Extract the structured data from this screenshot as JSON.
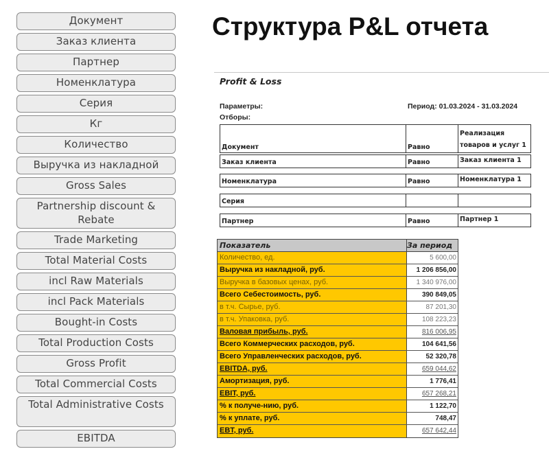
{
  "title": "Структура P&L отчета",
  "sidebar": {
    "items": [
      {
        "label": "Документ"
      },
      {
        "label": "Заказ клиента"
      },
      {
        "label": "Партнер"
      },
      {
        "label": "Номенклатура"
      },
      {
        "label": "Серия"
      },
      {
        "label": "Кг"
      },
      {
        "label": "Количество"
      },
      {
        "label": "Выручка из накладной"
      },
      {
        "label": "Gross Sales"
      },
      {
        "label": "Partnership discount & Rebate"
      },
      {
        "label": "Trade Marketing"
      },
      {
        "label": "Total Material Costs"
      },
      {
        "label": "incl Raw Materials"
      },
      {
        "label": "incl Pack Materials"
      },
      {
        "label": "Bought-in Costs"
      },
      {
        "label": "Total Production Costs"
      },
      {
        "label": "Gross Profit"
      },
      {
        "label": "Total Commercial Costs"
      },
      {
        "label": "Total Administrative Costs"
      },
      {
        "label": "EBITDA"
      }
    ]
  },
  "report": {
    "title": "Profit & Loss",
    "params_label": "Параметры:",
    "period": "Период: 01.03.2024 - 31.03.2024",
    "filters_label": "Отборы:",
    "filters": [
      {
        "field": "Документ",
        "condition": "Равно",
        "value": "Реализация\nтоваров и услуг 1"
      },
      {
        "field": "Заказ клиента",
        "condition": "Равно",
        "value": "Заказ клиента 1"
      },
      {
        "field": "Номенклатура",
        "condition": "Равно",
        "value": "Номенклатура 1"
      },
      {
        "field": "Серия",
        "condition": "",
        "value": ""
      },
      {
        "field": "Партнер",
        "condition": "Равно",
        "value": "Партнер 1"
      }
    ],
    "table": {
      "headers": [
        "Показатель",
        "За период"
      ],
      "rows": [
        {
          "label": "Количество, ед.",
          "value": "5 600,00",
          "style": "muted"
        },
        {
          "label": "Выручка из накладной, руб.",
          "value": "1 206 856,00",
          "style": "bold"
        },
        {
          "label": "Выручка в базовых ценах, руб.",
          "value": "1 340 976,00",
          "style": "muted"
        },
        {
          "label": "Всего Себестоимость, руб.",
          "value": "390 849,05",
          "style": "bold"
        },
        {
          "label": "в т.ч. Сырье, руб.",
          "value": "87 201,30",
          "style": "muted"
        },
        {
          "label": "в т.ч. Упаковка, руб.",
          "value": "108 223,23",
          "style": "muted"
        },
        {
          "label": "Валовая прибыль, руб.",
          "value": "816 006,95",
          "style": "ul"
        },
        {
          "label": "Всего Коммерческих расходов, руб.",
          "value": "104 641,56",
          "style": "bold"
        },
        {
          "label": "Всего Управленческих расходов, руб.",
          "value": "52 320,78",
          "style": "bold"
        },
        {
          "label": "EBITDA, руб.",
          "value": "659 044,62",
          "style": "ul"
        },
        {
          "label": "Амортизация, руб.",
          "value": "1 776,41",
          "style": "bold"
        },
        {
          "label": "EBIT, руб.",
          "value": "657 268,21",
          "style": "ul"
        },
        {
          "label": "% к получе-нию, руб.",
          "value": "1 122,70",
          "style": "bold"
        },
        {
          "label": "% к уплате, руб.",
          "value": "748,47",
          "style": "bold"
        },
        {
          "label": "EBT, руб.",
          "value": "657 642,44",
          "style": "ul"
        }
      ]
    }
  },
  "colors": {
    "highlight": "#ffc800",
    "header_gray": "#c8c8c8"
  }
}
